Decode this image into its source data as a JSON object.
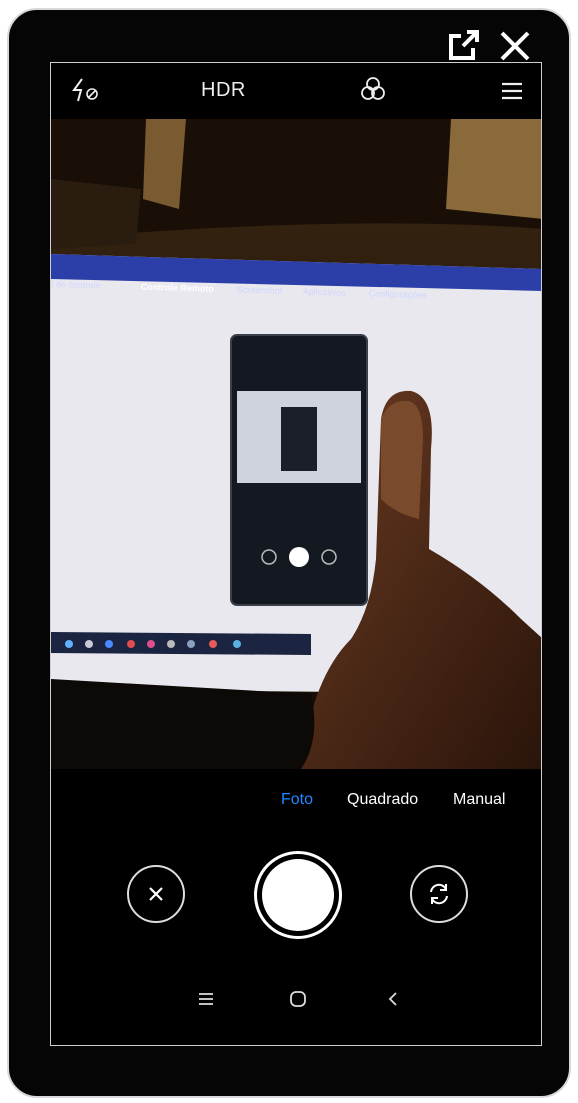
{
  "window": {
    "popout_icon": "external-link-icon",
    "close_icon": "close-icon"
  },
  "camera": {
    "flash_icon": "flash-off-icon",
    "hdr_label": "HDR",
    "filter_icon": "filters-icon",
    "menu_icon": "hamburger-menu-icon"
  },
  "viewfinder": {
    "screen_tabs": [
      "...el de controle",
      "Controle Remoto",
      "Screenshot",
      "Aplicativos",
      "Configurações"
    ]
  },
  "modes": {
    "items": [
      "Foto",
      "Quadrado",
      "Manual"
    ],
    "active": "Foto"
  },
  "controls": {
    "cancel_icon": "close-circle-icon",
    "shutter_icon": "shutter-icon",
    "switch_camera_icon": "switch-camera-icon"
  },
  "navbar": {
    "recents_icon": "recents-icon",
    "home_icon": "home-icon",
    "back_icon": "back-icon"
  },
  "colors": {
    "active_mode": "#1e88ff",
    "background": "#000000"
  }
}
